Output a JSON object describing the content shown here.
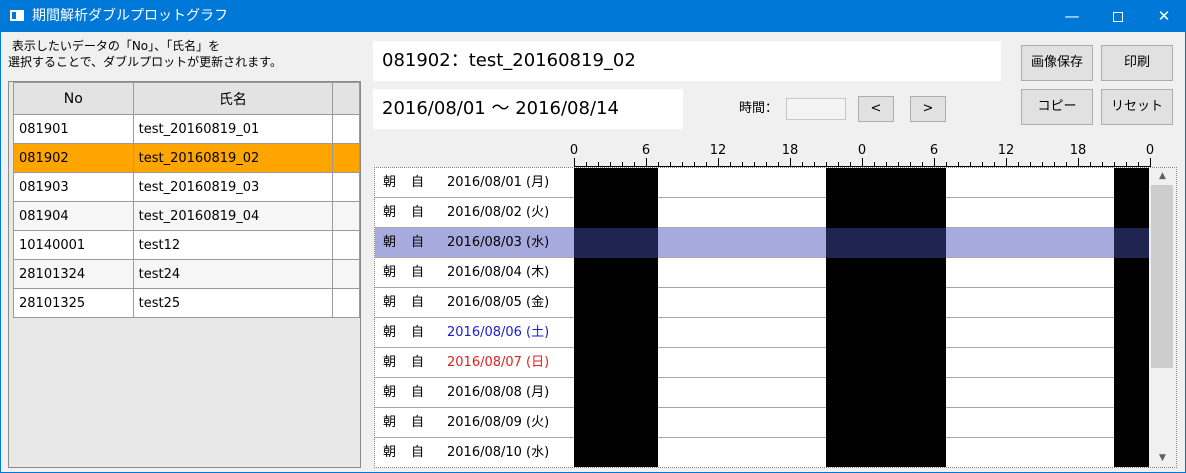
{
  "window": {
    "title": "期間解析ダブルプロットグラフ",
    "minimize_glyph": "—",
    "close_glyph": "✕"
  },
  "instruction": [
    " 表示したいデータの「No」、「氏名」を",
    "選択することで、ダブルプロットが更新されます。"
  ],
  "list": {
    "columns": [
      "No",
      "氏名"
    ],
    "rows": [
      {
        "no": "081901",
        "name": "test_20160819_01"
      },
      {
        "no": "081902",
        "name": "test_20160819_02",
        "selected": true
      },
      {
        "no": "081903",
        "name": "test_20160819_03"
      },
      {
        "no": "081904",
        "name": "test_20160819_04"
      },
      {
        "no": "10140001",
        "name": "test12"
      },
      {
        "no": "28101324",
        "name": "test24"
      },
      {
        "no": "28101325",
        "name": "test25"
      }
    ]
  },
  "header": {
    "subject": "081902：test_20160819_02",
    "period": "2016/08/01 〜 2016/08/14"
  },
  "controls": {
    "time_label": "時間：",
    "time_value": "",
    "prev_label": "<",
    "next_label": ">",
    "save_image_label": "画像保存",
    "print_label": "印刷",
    "copy_label": "コピー",
    "reset_label": "リセット"
  },
  "plot": {
    "axis_tick_labels": [
      "0",
      "6",
      "12",
      "18",
      "0",
      "6",
      "12",
      "18",
      "0"
    ],
    "axis_hours_span": 48,
    "rows": [
      {
        "period": "朝",
        "type": "自",
        "date": "2016/08/01 (月)",
        "color": "#000000"
      },
      {
        "period": "朝",
        "type": "自",
        "date": "2016/08/02 (火)",
        "color": "#000000"
      },
      {
        "period": "朝",
        "type": "自",
        "date": "2016/08/03 (水)",
        "color": "#000000",
        "selected": true
      },
      {
        "period": "朝",
        "type": "自",
        "date": "2016/08/04 (木)",
        "color": "#000000"
      },
      {
        "period": "朝",
        "type": "自",
        "date": "2016/08/05 (金)",
        "color": "#000000"
      },
      {
        "period": "朝",
        "type": "自",
        "date": "2016/08/06 (土)",
        "color": "#1a1ad6"
      },
      {
        "period": "朝",
        "type": "自",
        "date": "2016/08/07 (日)",
        "color": "#e02020"
      },
      {
        "period": "朝",
        "type": "自",
        "date": "2016/08/08 (月)",
        "color": "#000000"
      },
      {
        "period": "朝",
        "type": "自",
        "date": "2016/08/09 (火)",
        "color": "#000000"
      },
      {
        "period": "朝",
        "type": "自",
        "date": "2016/08/10 (水)",
        "color": "#000000"
      }
    ],
    "sleep_periods_hours": [
      [
        0,
        7
      ],
      [
        21,
        31
      ],
      [
        45,
        48
      ]
    ],
    "selected_row_color": "#a6aadc",
    "selected_row_bar_color": "#1f2550"
  },
  "colors": {
    "titlebar": "#0078d7",
    "list_selected": "#ffa500"
  },
  "scrollbar": {
    "up_glyph": "▲",
    "down_glyph": "▼"
  }
}
